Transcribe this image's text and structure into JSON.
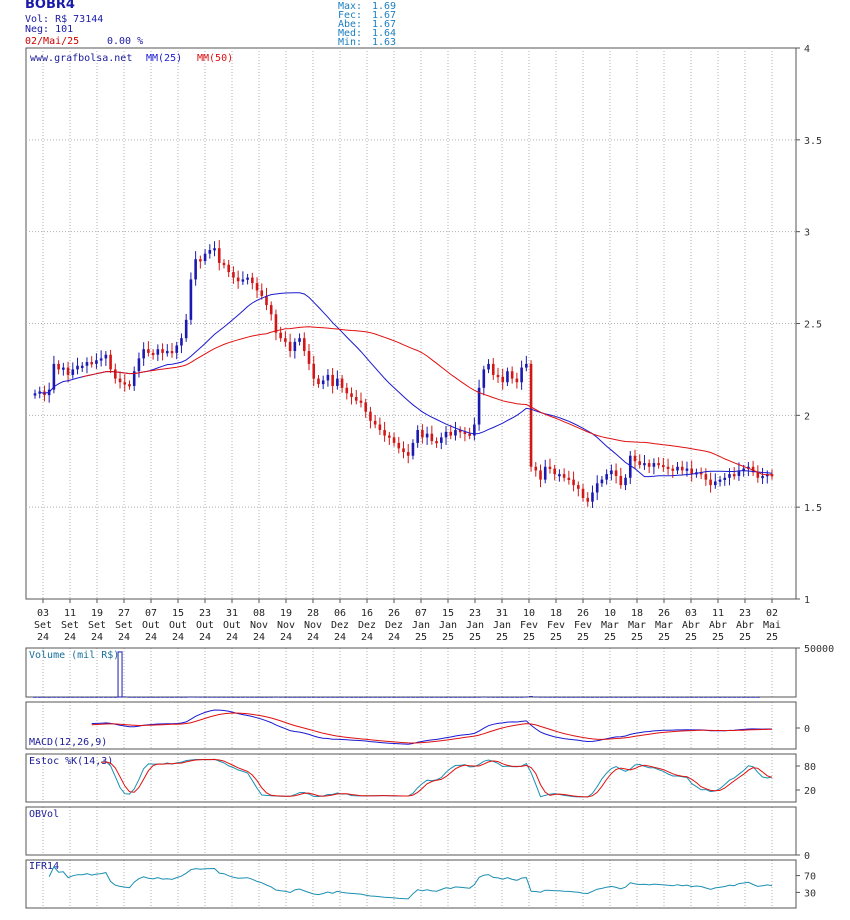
{
  "header": {
    "ticker": "BOBR4",
    "volume": "Vol: R$ 73144",
    "trades": "Neg: 101",
    "date": "02/Mai/25",
    "change": "0.00 %",
    "stats": [
      {
        "label": "Max:",
        "value": "1.69"
      },
      {
        "label": "Fec:",
        "value": "1.67"
      },
      {
        "label": "Abe:",
        "value": "1.67"
      },
      {
        "label": "Med:",
        "value": "1.64"
      },
      {
        "label": "Min:",
        "value": "1.63"
      }
    ]
  },
  "colors": {
    "up": "#1a1ab0",
    "down": "#d01818",
    "ma25": "#1a1ad0",
    "ma50": "#e01010",
    "grid": "#b0b0b0",
    "cyan": "#1a8fb0"
  },
  "chart_data": [
    {
      "type": "candlestick",
      "source": "www.grafbolsa.net",
      "legend": [
        {
          "name": "MM(25)",
          "color": "#1a1ad0"
        },
        {
          "name": "MM(50)",
          "color": "#e01010"
        }
      ],
      "ylim": [
        1,
        4
      ],
      "yticks": [
        "4",
        "3.5",
        "3",
        "2.5",
        "2",
        "1.5",
        "1"
      ],
      "xticks": [
        {
          "day": "03",
          "month": "Set",
          "year": "24"
        },
        {
          "day": "11",
          "month": "Set",
          "year": "24"
        },
        {
          "day": "19",
          "month": "Set",
          "year": "24"
        },
        {
          "day": "27",
          "month": "Set",
          "year": "24"
        },
        {
          "day": "07",
          "month": "Out",
          "year": "24"
        },
        {
          "day": "15",
          "month": "Out",
          "year": "24"
        },
        {
          "day": "23",
          "month": "Out",
          "year": "24"
        },
        {
          "day": "31",
          "month": "Out",
          "year": "24"
        },
        {
          "day": "08",
          "month": "Nov",
          "year": "24"
        },
        {
          "day": "19",
          "month": "Nov",
          "year": "24"
        },
        {
          "day": "28",
          "month": "Nov",
          "year": "24"
        },
        {
          "day": "06",
          "month": "Dez",
          "year": "24"
        },
        {
          "day": "16",
          "month": "Dez",
          "year": "24"
        },
        {
          "day": "26",
          "month": "Dez",
          "year": "24"
        },
        {
          "day": "07",
          "month": "Jan",
          "year": "25"
        },
        {
          "day": "15",
          "month": "Jan",
          "year": "25"
        },
        {
          "day": "23",
          "month": "Jan",
          "year": "25"
        },
        {
          "day": "31",
          "month": "Jan",
          "year": "25"
        },
        {
          "day": "10",
          "month": "Fev",
          "year": "25"
        },
        {
          "day": "18",
          "month": "Fev",
          "year": "25"
        },
        {
          "day": "26",
          "month": "Fev",
          "year": "25"
        },
        {
          "day": "10",
          "month": "Mar",
          "year": "25"
        },
        {
          "day": "18",
          "month": "Mar",
          "year": "25"
        },
        {
          "day": "26",
          "month": "Mar",
          "year": "25"
        },
        {
          "day": "03",
          "month": "Abr",
          "year": "25"
        },
        {
          "day": "11",
          "month": "Abr",
          "year": "25"
        },
        {
          "day": "23",
          "month": "Abr",
          "year": "25"
        },
        {
          "day": "02",
          "month": "Mai",
          "year": "25"
        }
      ],
      "close": [
        2.12,
        2.13,
        2.11,
        2.14,
        2.28,
        2.25,
        2.26,
        2.22,
        2.25,
        2.27,
        2.27,
        2.29,
        2.28,
        2.3,
        2.31,
        2.33,
        2.25,
        2.2,
        2.18,
        2.17,
        2.16,
        2.24,
        2.31,
        2.36,
        2.34,
        2.33,
        2.36,
        2.34,
        2.35,
        2.34,
        2.38,
        2.42,
        2.52,
        2.74,
        2.85,
        2.84,
        2.88,
        2.9,
        2.91,
        2.83,
        2.82,
        2.78,
        2.75,
        2.73,
        2.74,
        2.75,
        2.72,
        2.68,
        2.65,
        2.6,
        2.55,
        2.45,
        2.42,
        2.4,
        2.35,
        2.4,
        2.42,
        2.35,
        2.28,
        2.2,
        2.17,
        2.19,
        2.22,
        2.16,
        2.2,
        2.15,
        2.12,
        2.1,
        2.08,
        2.07,
        2.02,
        1.97,
        1.95,
        1.92,
        1.89,
        1.88,
        1.85,
        1.82,
        1.8,
        1.78,
        1.85,
        1.92,
        1.88,
        1.9,
        1.86,
        1.85,
        1.88,
        1.91,
        1.89,
        1.92,
        1.91,
        1.9,
        1.89,
        1.95,
        2.15,
        2.25,
        2.28,
        2.22,
        2.21,
        2.18,
        2.24,
        2.2,
        2.18,
        2.26,
        2.28,
        1.72,
        1.7,
        1.65,
        1.72,
        1.71,
        1.68,
        1.68,
        1.66,
        1.65,
        1.62,
        1.6,
        1.55,
        1.53,
        1.58,
        1.63,
        1.65,
        1.68,
        1.7,
        1.67,
        1.62,
        1.66,
        1.78,
        1.75,
        1.73,
        1.74,
        1.72,
        1.74,
        1.73,
        1.72,
        1.71,
        1.7,
        1.72,
        1.7,
        1.71,
        1.68,
        1.69,
        1.68,
        1.65,
        1.62,
        1.64,
        1.65,
        1.66,
        1.68,
        1.67,
        1.7,
        1.71,
        1.72,
        1.69,
        1.66,
        1.67,
        1.68,
        1.67
      ]
    },
    {
      "type": "bar",
      "title": "Volume (mil R$)",
      "ylim": [
        0,
        50000
      ],
      "yticks": [
        "50000"
      ],
      "values": [
        120,
        90,
        100,
        80,
        140,
        110,
        100,
        90,
        100,
        120,
        80,
        110,
        90,
        100,
        130,
        100,
        120,
        80,
        46000,
        500,
        150,
        120,
        110,
        100,
        90,
        100,
        110,
        120,
        90,
        100,
        130,
        120,
        150,
        400,
        250,
        200,
        150,
        180,
        160,
        140,
        130,
        120,
        100,
        110,
        130,
        150,
        120,
        100,
        90,
        110,
        120,
        250,
        180,
        100,
        120,
        110,
        90,
        100,
        130,
        120,
        100,
        110,
        120,
        90,
        100,
        110,
        130,
        100,
        90,
        80,
        110,
        100,
        120,
        90,
        100,
        110,
        90,
        120,
        100,
        110,
        100,
        90,
        110,
        120,
        100,
        130,
        100,
        90,
        110,
        100,
        120,
        110,
        100,
        90,
        150,
        300,
        180,
        130,
        120,
        110,
        100,
        120,
        110,
        130,
        300,
        900,
        400,
        200,
        180,
        150,
        140,
        130,
        120,
        110,
        100,
        120,
        110,
        100,
        90,
        110,
        120,
        100,
        130,
        120,
        110,
        100,
        90,
        110,
        100,
        120,
        90,
        100,
        110,
        100,
        90,
        110,
        100,
        120,
        100,
        90,
        110,
        100,
        120,
        110,
        100,
        90,
        110,
        100,
        120,
        110,
        100,
        90,
        100,
        110
      ]
    },
    {
      "type": "line",
      "title": "MACD(12,26,9)",
      "yticks": [
        "0"
      ]
    },
    {
      "type": "line",
      "title": "Estoc %K(14,3)",
      "yticks": [
        "80",
        "20"
      ]
    },
    {
      "type": "line",
      "title": "OBVol",
      "yticks": [
        "0"
      ]
    },
    {
      "type": "line",
      "title": "IFR14",
      "yticks": [
        "70",
        "30"
      ]
    }
  ]
}
